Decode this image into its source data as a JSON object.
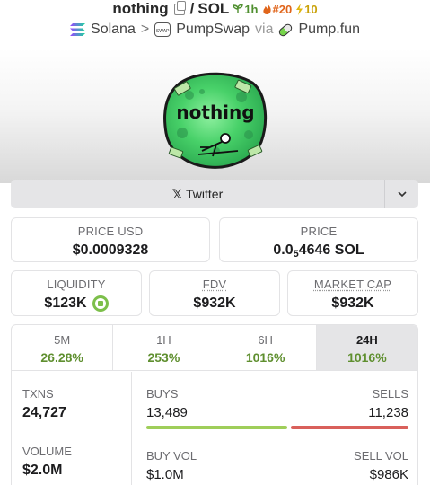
{
  "header": {
    "token": "nothing",
    "separator": "/",
    "quote": "SOL",
    "age": "1h",
    "rank": "#20",
    "boosts": "10"
  },
  "chain": {
    "chain_name": "Solana",
    "chevron": ">",
    "dex": "PumpSwap",
    "via": "via",
    "launchpad": "Pump.fun"
  },
  "logo": {
    "text": "nothing"
  },
  "twitter": {
    "label": "Twitter",
    "x": "𝕏",
    "chevron": "⌄"
  },
  "prices": {
    "price_usd_label": "PRICE USD",
    "price_usd": "$0.0009328",
    "price_label": "PRICE",
    "price_pre": "0.0",
    "price_sub": "5",
    "price_post": "4646 SOL"
  },
  "metrics": {
    "liquidity_label": "LIQUIDITY",
    "liquidity": "$123K",
    "fdv_label": "FDV",
    "fdv": "$932K",
    "mcap_label": "MARKET CAP",
    "mcap": "$932K"
  },
  "timeframes": [
    {
      "label": "5M",
      "value": "26.28%"
    },
    {
      "label": "1H",
      "value": "253%"
    },
    {
      "label": "6H",
      "value": "1016%"
    },
    {
      "label": "24H",
      "value": "1016%"
    }
  ],
  "active_timeframe": "24H",
  "txns": {
    "txns_label": "TXNS",
    "txns": "24,727",
    "buys_label": "BUYS",
    "buys": "13,489",
    "sells_label": "SELLS",
    "sells": "11,238",
    "buy_fraction": 0.545
  },
  "volume": {
    "volume_label": "VOLUME",
    "volume": "$2.0M",
    "buy_vol_label": "BUY VOL",
    "buy_vol": "$1.0M",
    "sell_vol_label": "SELL VOL",
    "sell_vol": "$986K",
    "buy_fraction": 0.505
  },
  "colors": {
    "positive": "#5f8f2f",
    "buy_bar": "#9fce5a",
    "sell_bar": "#d9605b",
    "logo_green": "#5ee07a"
  }
}
